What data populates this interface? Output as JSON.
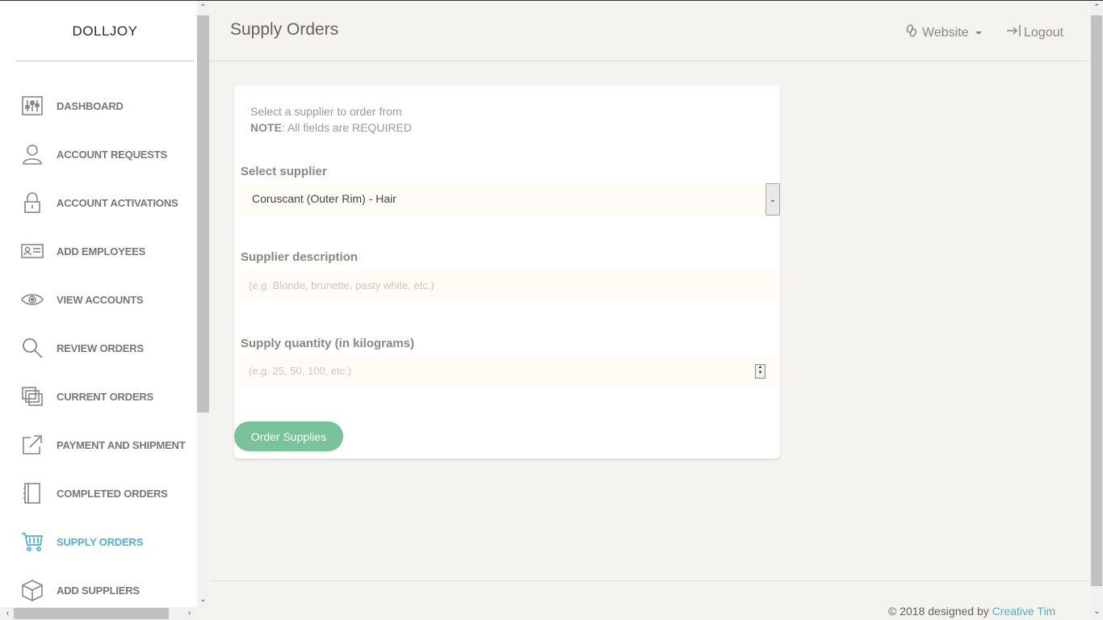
{
  "brand": "DOLLJOY",
  "sidebar": {
    "items": [
      {
        "label": "DASHBOARD",
        "icon": "dashboard-sliders-icon"
      },
      {
        "label": "ACCOUNT REQUESTS",
        "icon": "user-icon"
      },
      {
        "label": "ACCOUNT ACTIVATIONS",
        "icon": "lock-icon"
      },
      {
        "label": "ADD EMPLOYEES",
        "icon": "id-card-icon"
      },
      {
        "label": "VIEW ACCOUNTS",
        "icon": "eye-icon"
      },
      {
        "label": "REVIEW ORDERS",
        "icon": "search-icon"
      },
      {
        "label": "CURRENT ORDERS",
        "icon": "layers-icon"
      },
      {
        "label": "PAYMENT AND SHIPMENT",
        "icon": "external-link-icon"
      },
      {
        "label": "COMPLETED ORDERS",
        "icon": "notebook-icon"
      },
      {
        "label": "SUPPLY ORDERS",
        "icon": "cart-icon",
        "active": true
      },
      {
        "label": "ADD SUPPLIERS",
        "icon": "box-icon"
      }
    ]
  },
  "header": {
    "title": "Supply Orders",
    "website_label": "Website",
    "logout_label": "Logout"
  },
  "form": {
    "intro_line": "Select a supplier to order from",
    "note_label": "NOTE",
    "note_text": ": All fields are REQUIRED",
    "supplier_label": "Select supplier",
    "supplier_value": "Coruscant (Outer Rim) - Hair",
    "description_label": "Supplier description",
    "description_placeholder": "(e.g. Blonde, brunette, pasty white, etc.)",
    "quantity_label": "Supply quantity (in kilograms)",
    "quantity_placeholder": "(e.g. 25, 50, 100, etc.)",
    "submit_label": "Order Supplies"
  },
  "footer": {
    "text": "© 2018 designed by ",
    "link": "Creative Tim"
  },
  "colors": {
    "accent": "#51aed0",
    "button": "#7ac29a",
    "background": "#f4f3ef",
    "input_bg": "#fffcf5"
  }
}
